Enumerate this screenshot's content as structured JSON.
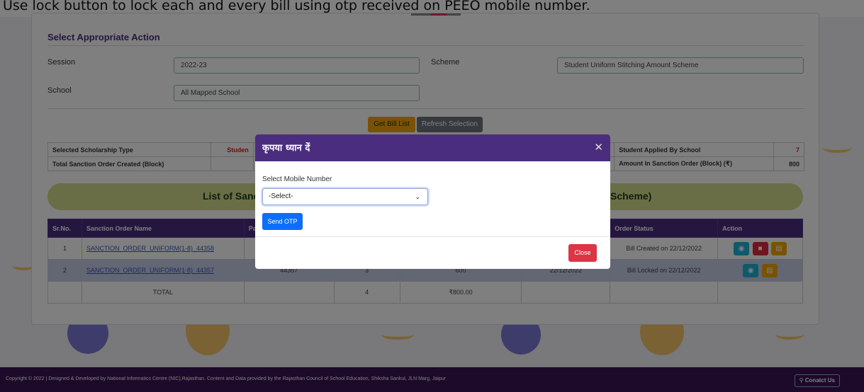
{
  "instruction": "Use lock button to lock each and every bill using otp received on PEEO mobile number.",
  "section_title": "Select Appropriate Action",
  "form": {
    "session_label": "Session",
    "session_value": "2022-23",
    "scheme_label": "Scheme",
    "scheme_value": "Student Uniform Stitching Amount Scheme",
    "school_label": "School",
    "school_value": "All Mapped School"
  },
  "buttons": {
    "get_bill_list": "Get Bill List",
    "refresh_selection": "Refresh Selection"
  },
  "summary": {
    "selected_type_label": "Selected Scholarship Type",
    "selected_type_value": "Studen",
    "total_sanction_label": "Total Sanction Order Created (Block)",
    "applied_label": "Student Applied By School",
    "applied_value": "7",
    "amount_label": "Amount In Sanction Order (Block) (₹)",
    "amount_value": "800"
  },
  "banner": {
    "left": "List of Sanc",
    "right": "Scheme)"
  },
  "table": {
    "headers": [
      "Sr.No.",
      "Sanction Order Name",
      "Pa",
      "",
      "",
      "",
      "Order Status",
      "Action"
    ],
    "rows": [
      {
        "sr": "1",
        "name": "SANCTION_ORDER_UNIFORM(1-8)_44358",
        "c3": "",
        "c4": "",
        "c5": "",
        "c6": "",
        "status": "Bill Created on 22/12/2022"
      },
      {
        "sr": "2",
        "name": "SANCTION_ORDER_UNIFORM(1-8)_44357",
        "c3": "44357",
        "c4": "3",
        "c5": "600",
        "c6": "22/12/2022",
        "status": "Bill Locked on 22/12/2022"
      }
    ],
    "total": {
      "label": "TOTAL",
      "count": "4",
      "amount": "₹800.00"
    }
  },
  "modal": {
    "title": "कृपया ध्यान दें",
    "select_label": "Select Mobile Number",
    "select_value": "-Select-",
    "send_otp": "Send OTP",
    "close": "Close"
  },
  "footer": {
    "text": "Copyright © 2022 | Designed & Developed by National Informatics Centre (NIC),Rajasthan. Content and Data provided by the Rajasthan Council of School Education, Shiksha Sankul, JLN Marg, Jaipur",
    "contact": "Conatct Us"
  },
  "icons": {
    "eye": "eye-icon",
    "lock": "lock-icon",
    "print": "print-icon",
    "close": "close-icon",
    "chevron": "chevron-down-icon",
    "location": "location-pin-icon"
  },
  "colors": {
    "primary": "#4b2d7f",
    "warning": "#f0a60b",
    "danger": "#dc3545",
    "info": "#1eb3d9",
    "blue": "#0d6efd",
    "banner": "#d3dd8c"
  }
}
